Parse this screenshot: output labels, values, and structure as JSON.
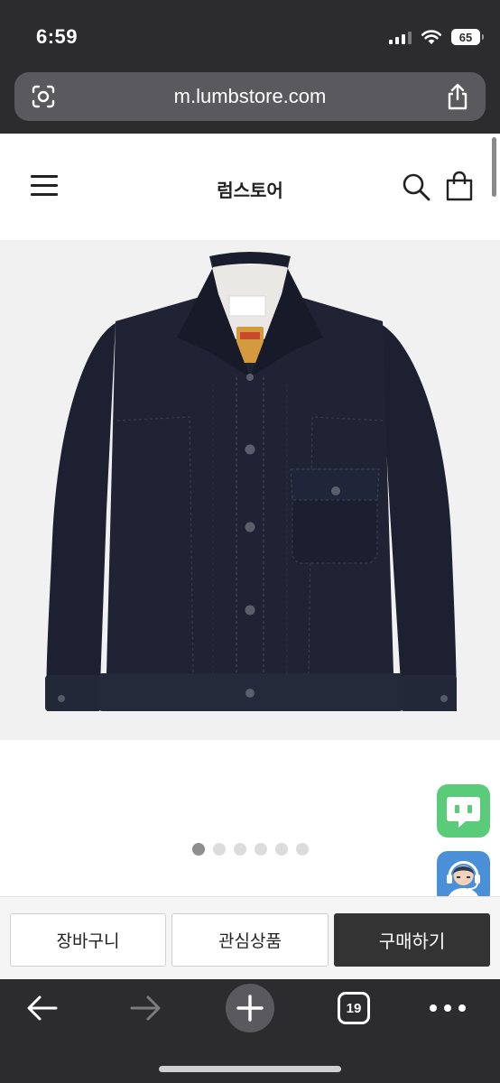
{
  "status_bar": {
    "time": "6:59",
    "battery": "65",
    "icons": [
      "signal-icon",
      "wifi-icon",
      "battery-icon"
    ]
  },
  "browser": {
    "url": "m.lumbstore.com",
    "icons": [
      "lens-icon",
      "share-icon"
    ]
  },
  "site_header": {
    "title": "럼스토어",
    "icons": [
      "menu-icon",
      "search-icon",
      "cart-icon"
    ]
  },
  "product": {
    "image": "navy-corduroy-trucker-jacket",
    "carousel": {
      "total": 6,
      "active_index": 0
    }
  },
  "floating": {
    "chat": "chat-bubble-icon",
    "support": "headset-agent-icon"
  },
  "actions": {
    "cart_label": "장바구니",
    "wishlist_label": "관심상품",
    "buy_label": "구매하기"
  },
  "toolbar": {
    "tab_count": "19",
    "icons": [
      "back-arrow-icon",
      "forward-arrow-icon",
      "plus-icon",
      "tabs-icon",
      "more-icon"
    ]
  },
  "colors": {
    "chrome": "#2c2c2e",
    "buy_button": "#333333",
    "chat_green": "#5acb79",
    "support_blue": "#4a90d9",
    "jacket_navy": "#1e2233"
  }
}
